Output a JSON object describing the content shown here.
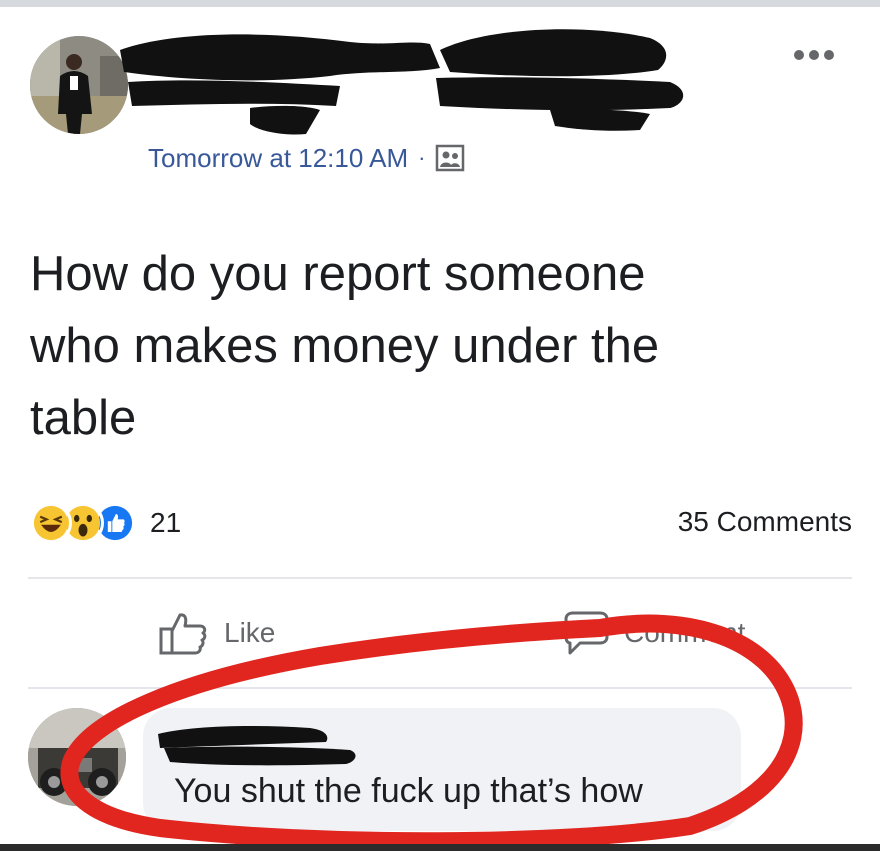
{
  "post": {
    "timestamp": "Tomorrow at 12:10 AM",
    "separator": "·",
    "privacy_icon": "friends-privacy-icon",
    "text": "How do you report someone\nwho makes money under the\ntable",
    "more_icon": "more-options-icon"
  },
  "engagement": {
    "reactions": [
      "haha-icon",
      "wow-icon",
      "like-icon"
    ],
    "reaction_count": "21",
    "comments_count": "35 Comments"
  },
  "actions": {
    "like_label": "Like",
    "like_icon": "thumbs-up-icon",
    "comment_label": "Comment",
    "comment_icon": "speech-bubble-icon"
  },
  "comment": {
    "text": "You shut the fuck up that’s how"
  },
  "colors": {
    "timestamp_blue": "#385898",
    "redaction_black": "#111111",
    "annotation_red": "#e0261f",
    "like_blue": "#1877f2",
    "reaction_yellow": "#f7c531",
    "comment_bg": "#f0f2f5"
  }
}
